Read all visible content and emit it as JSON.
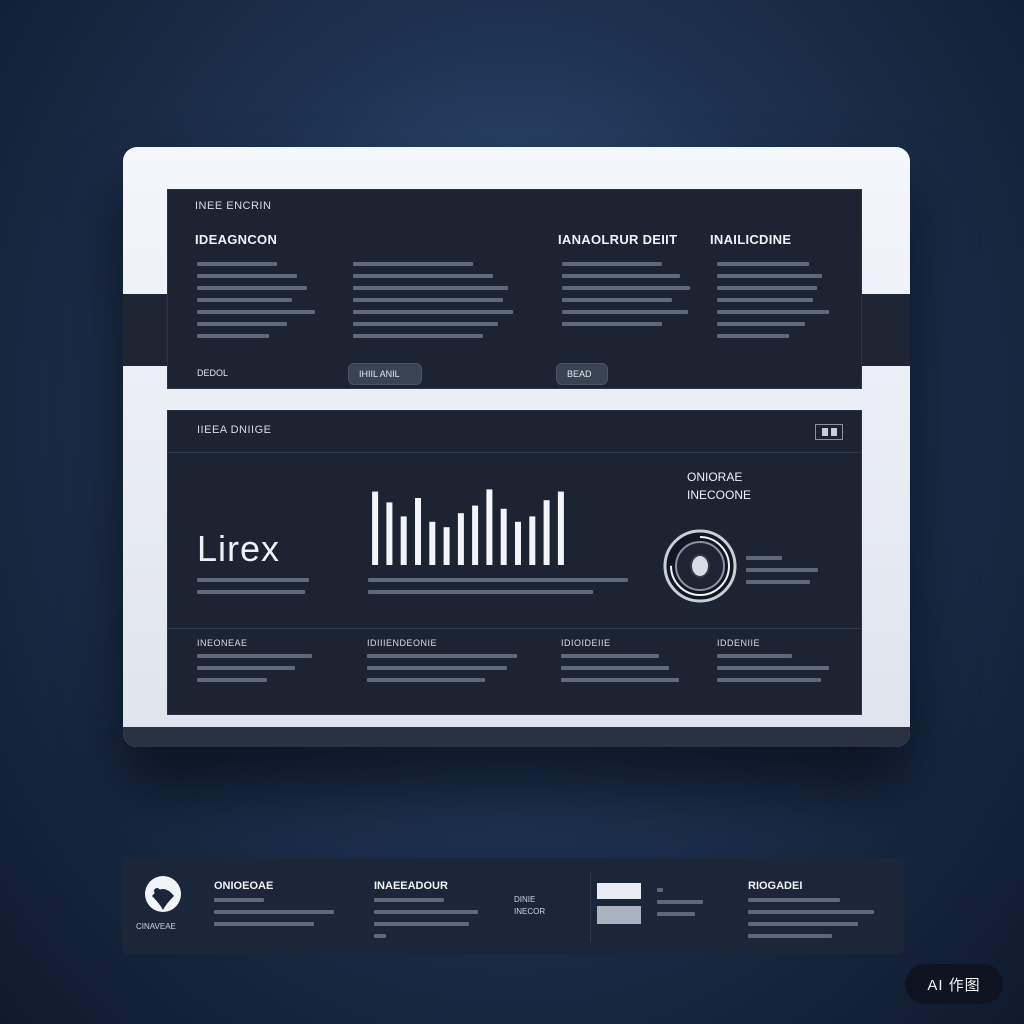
{
  "top_panel": {
    "header": "INEE ENCRIN",
    "columns": [
      {
        "title": "IDEAGNCON",
        "button": "DEDOL"
      },
      {
        "title": "",
        "button": "IHIIL ANIL"
      },
      {
        "title": "IANAOLRUR DEIIT",
        "button": "BEAD"
      },
      {
        "title": "INAILICDINE",
        "button": ""
      }
    ]
  },
  "mid_panel": {
    "header": "IIEEA DNIIGE",
    "big_word": "Lirex",
    "gauge_title_line1": "ONIORAE",
    "gauge_title_line2": "INECOONE",
    "chart_data": {
      "type": "bar",
      "categories": [
        "",
        "",
        "",
        "",
        "",
        "",
        "",
        "",
        "",
        "",
        "",
        "",
        "",
        ""
      ],
      "values": [
        68,
        58,
        45,
        62,
        40,
        35,
        48,
        55,
        70,
        52,
        40,
        45,
        60,
        68
      ],
      "ylim": [
        0,
        75
      ]
    },
    "footer_columns": [
      "INEONEAE",
      "IDIIIENDEONIE",
      "IDIOIDEIIE",
      "IDDENIIE"
    ],
    "gauge_value": 0.75
  },
  "bottom_strip": {
    "logo_caption": "CINAVEAE",
    "items": [
      {
        "title": "ONIOEOAE"
      },
      {
        "title": "INAEEADOUR"
      },
      {
        "title": "RIOGADEI"
      }
    ],
    "center_caption_1": "DINIE",
    "center_caption_2": "INECOR"
  },
  "badge": {
    "label": "AI 作图"
  },
  "colors": {
    "panel": "#1c2432",
    "frame": "#f4f6fb",
    "bars": "#f2f4f8"
  }
}
